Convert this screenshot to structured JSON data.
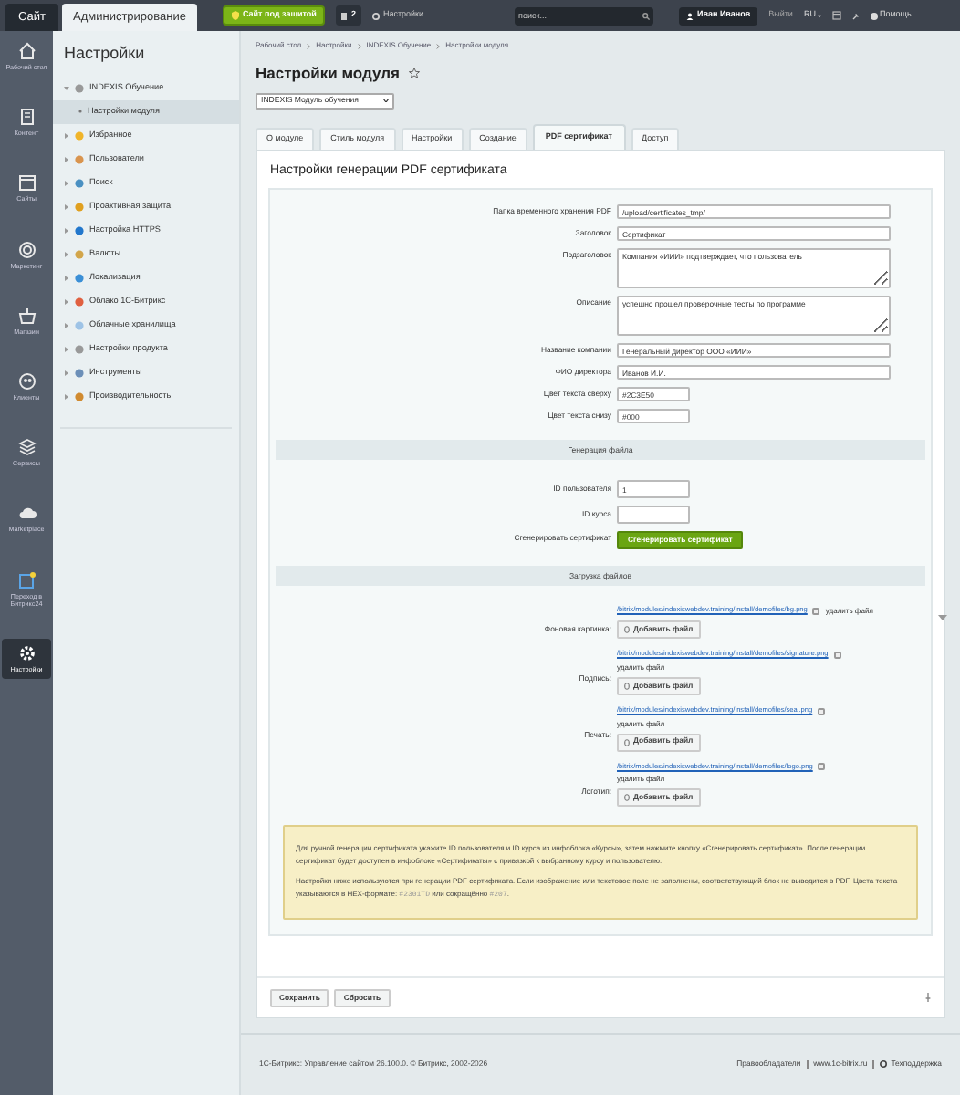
{
  "top_bar": {
    "tabs": [
      {
        "label": "Сайт",
        "selected": false
      },
      {
        "label": "Администрирование",
        "selected": true
      }
    ],
    "protect_button": "Сайт под защитой",
    "notifications_count": "2",
    "settings_link": "Настройки",
    "search": {
      "placeholder": "поиск..."
    },
    "user": "Иван Иванов",
    "logout": "Выйти",
    "language": "RU",
    "help": "Помощь"
  },
  "nav_rail": [
    {
      "label": "Рабочий стол",
      "selected": false
    },
    {
      "label": "Контент",
      "selected": false
    },
    {
      "label": "Сайты",
      "selected": false
    },
    {
      "label": "Маркетинг",
      "selected": false
    },
    {
      "label": "Магазин",
      "selected": false
    },
    {
      "label": "Клиенты",
      "selected": false
    },
    {
      "label": "Сервисы",
      "selected": false
    },
    {
      "label": "Marketplace",
      "selected": false
    },
    {
      "label": "Переход в Битрикс24",
      "selected": false
    },
    {
      "label": "Настройки",
      "selected": true
    }
  ],
  "sidebar": {
    "title": "Настройки",
    "items": [
      {
        "label": "INDEXIS Обучение",
        "expanded": true,
        "selected": false,
        "children": [
          {
            "label": "Настройки модуля",
            "selected": true
          }
        ]
      },
      {
        "label": "Избранное",
        "expanded": false,
        "selected": false
      },
      {
        "label": "Пользователи",
        "expanded": false,
        "selected": false
      },
      {
        "label": "Поиск",
        "expanded": false,
        "selected": false
      },
      {
        "label": "Проактивная защита",
        "expanded": false,
        "selected": false
      },
      {
        "label": "Настройка HTTPS",
        "expanded": false,
        "selected": false
      },
      {
        "label": "Валюты",
        "expanded": false,
        "selected": false
      },
      {
        "label": "Локализация",
        "expanded": false,
        "selected": false
      },
      {
        "label": "Облако 1С-Битрикс",
        "expanded": false,
        "selected": false
      },
      {
        "label": "Облачные хранилища",
        "expanded": false,
        "selected": false
      },
      {
        "label": "Настройки продукта",
        "expanded": false,
        "selected": false
      },
      {
        "label": "Инструменты",
        "expanded": false,
        "selected": false
      },
      {
        "label": "Производительность",
        "expanded": false,
        "selected": false
      }
    ]
  },
  "breadcrumbs": [
    "Рабочий стол",
    "Настройки",
    "INDEXIS Обучение",
    "Настройки модуля"
  ],
  "page_title": "Настройки модуля",
  "module_select": "INDEXIS Модуль обучения",
  "tabs": [
    {
      "label": "О модуле",
      "selected": false
    },
    {
      "label": "Стиль модуля",
      "selected": false
    },
    {
      "label": "Настройки",
      "selected": false
    },
    {
      "label": "Создание",
      "selected": false
    },
    {
      "label": "PDF сертификат",
      "selected": true
    },
    {
      "label": "Доступ",
      "selected": false
    }
  ],
  "card_title": "Настройки генерации PDF сертификата",
  "fields": [
    {
      "kind": "text",
      "label": "Папка временного хранения PDF",
      "value": "/upload/certificates_tmp/"
    },
    {
      "kind": "text",
      "label": "Заголовок",
      "value": "Сертификат"
    },
    {
      "kind": "textarea",
      "label": "Подзаголовок",
      "value": "Компания «ИИИ» подтверждает, что пользователь"
    },
    {
      "kind": "textarea",
      "label": "Описание",
      "value": "успешно прошел проверочные тесты по программе"
    },
    {
      "kind": "text",
      "label": "Название компании",
      "value": "Генеральный директор ООО «ИИИ»"
    },
    {
      "kind": "text",
      "label": "ФИО директора",
      "value": "Иванов И.И."
    },
    {
      "kind": "short",
      "label": "Цвет текста сверху",
      "value": "#2C3E50"
    },
    {
      "kind": "short",
      "label": "Цвет текста снизу",
      "value": "#000"
    }
  ],
  "generation": {
    "heading": "Генерация файла",
    "fields": [
      {
        "label": "ID пользователя",
        "value": "1"
      },
      {
        "label": "ID курса"
      }
    ],
    "button_label": "Сгенерировать сертификат",
    "button": "Сгенерировать сертификат"
  },
  "uploads": {
    "heading": "Загрузка файлов",
    "files": [
      {
        "label": "Фоновая картинка:",
        "path": "/bitrix/modules/indexiswebdev.training/install/demofiles/bg.png",
        "delete_label": "удалить файл",
        "checked": false,
        "button": "Добавить файл"
      },
      {
        "label": "Подпись:",
        "path": "/bitrix/modules/indexiswebdev.training/install/demofiles/signature.png",
        "delete_label": "удалить файл",
        "checked": false,
        "button": "Добавить файл"
      },
      {
        "label": "Печать:",
        "path": "/bitrix/modules/indexiswebdev.training/install/demofiles/seal.png",
        "delete_label": "удалить файл",
        "checked": false,
        "button": "Добавить файл"
      },
      {
        "label": "Логотип:",
        "path": "/bitrix/modules/indexiswebdev.training/install/demofiles/logo.png",
        "delete_label": "удалить файл",
        "checked": false,
        "button": "Добавить файл"
      }
    ]
  },
  "note": [
    [
      {
        "kind": "plain",
        "text": "Для ручной генерации сертификата укажите ID пользователя и ID курса из инфоблока «Курсы», затем нажмите кнопку «Сгенерировать сертификат». После генерации сертификат будет доступен в инфоблоке «Сертификаты» с привязкой к выбранному курсу и пользователю."
      }
    ],
    [
      {
        "kind": "plain",
        "text": "Настройки ниже используются при генерации PDF сертификата. Если изображение или текстовое поле не заполнены, соответствующий блок не выводится в PDF. Цвета текста указываются в HEX-формате: "
      },
      {
        "kind": "code",
        "text": "#2301TD"
      },
      {
        "kind": "plain",
        "text": " или сокращённо "
      },
      {
        "kind": "code",
        "text": "#207"
      },
      {
        "kind": "plain",
        "text": "."
      }
    ]
  ],
  "buttons": [
    "Сохранить",
    "Сбросить"
  ],
  "footer": {
    "copyright": "1С-Битрикс: Управление сайтом 26.100.0. © Битрикс, 2002-2026",
    "links": [
      "Правообладатели",
      "www.1c-bitrix.ru",
      "Техподдержка"
    ]
  }
}
